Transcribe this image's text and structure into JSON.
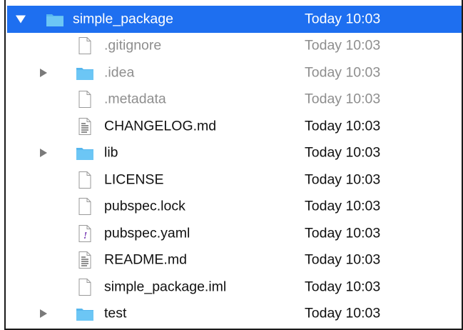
{
  "items": [
    {
      "name": "simple_package",
      "date": "Today 10:03",
      "icon": "folder-icon",
      "expandable": true,
      "selected": true,
      "dimmed": false
    },
    {
      "name": ".gitignore",
      "date": "Today 10:03",
      "icon": "document-icon",
      "expandable": false,
      "selected": false,
      "dimmed": true
    },
    {
      "name": ".idea",
      "date": "Today 10:03",
      "icon": "folder-icon",
      "expandable": true,
      "selected": false,
      "dimmed": true
    },
    {
      "name": ".metadata",
      "date": "Today 10:03",
      "icon": "document-icon",
      "expandable": false,
      "selected": false,
      "dimmed": true
    },
    {
      "name": "CHANGELOG.md",
      "date": "Today 10:03",
      "icon": "text-document-icon",
      "expandable": false,
      "selected": false,
      "dimmed": false
    },
    {
      "name": "lib",
      "date": "Today 10:03",
      "icon": "folder-icon",
      "expandable": true,
      "selected": false,
      "dimmed": false
    },
    {
      "name": "LICENSE",
      "date": "Today 10:03",
      "icon": "document-icon",
      "expandable": false,
      "selected": false,
      "dimmed": false
    },
    {
      "name": "pubspec.lock",
      "date": "Today 10:03",
      "icon": "document-icon",
      "expandable": false,
      "selected": false,
      "dimmed": false
    },
    {
      "name": "pubspec.yaml",
      "date": "Today 10:03",
      "icon": "yaml-document-icon",
      "expandable": false,
      "selected": false,
      "dimmed": false
    },
    {
      "name": "README.md",
      "date": "Today 10:03",
      "icon": "text-document-icon",
      "expandable": false,
      "selected": false,
      "dimmed": false
    },
    {
      "name": "simple_package.iml",
      "date": "Today 10:03",
      "icon": "document-icon",
      "expandable": false,
      "selected": false,
      "dimmed": false
    },
    {
      "name": "test",
      "date": "Today 10:03",
      "icon": "folder-icon",
      "expandable": true,
      "selected": false,
      "dimmed": false
    }
  ],
  "colors": {
    "selection": "#1e6ff0",
    "folder": "#57b7ee",
    "dimmed_text": "#8e8e8e"
  }
}
